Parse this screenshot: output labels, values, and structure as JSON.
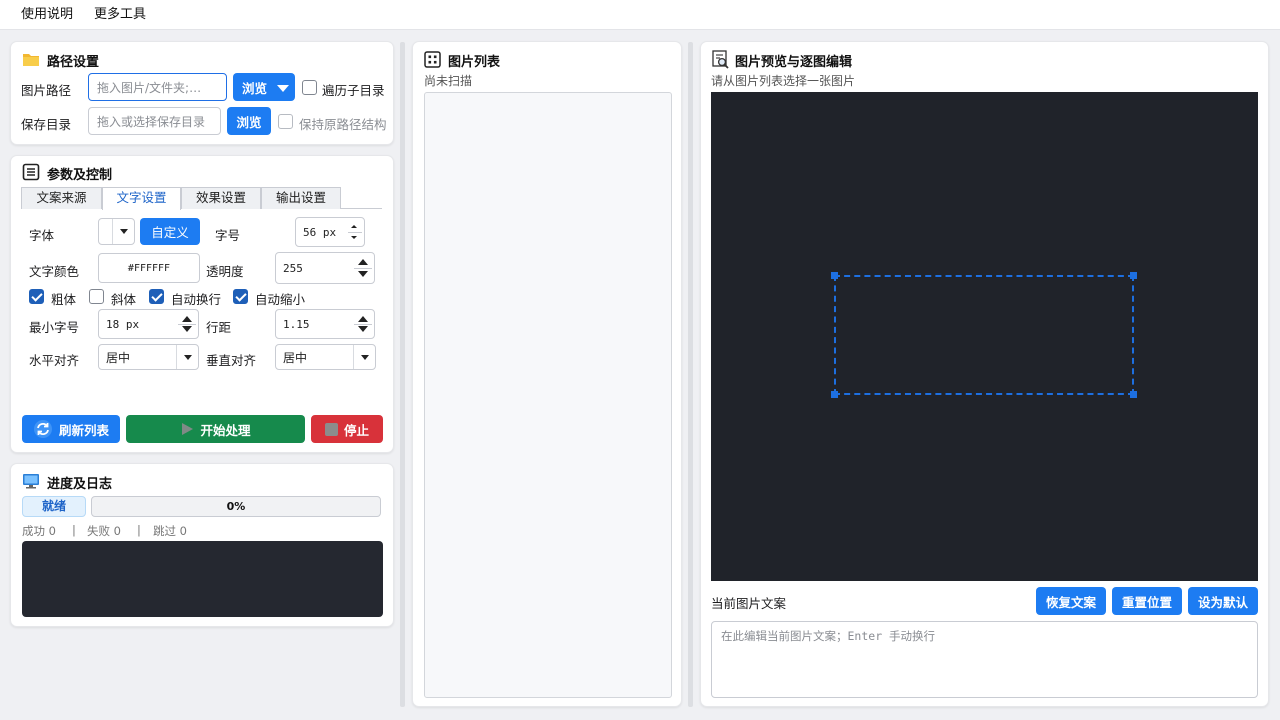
{
  "menu": {
    "help": "使用说明",
    "more_tools": "更多工具"
  },
  "path_settings": {
    "title": "路径设置",
    "image_path_label": "图片路径",
    "image_path_placeholder": "拖入图片/文件夹;…",
    "browse_label": "浏览",
    "recursive_label": "遍历子目录",
    "recursive_checked": false,
    "save_dir_label": "保存目录",
    "save_dir_placeholder": "拖入或选择保存目录",
    "save_browse_label": "浏览",
    "keep_structure_label": "保持原路径结构",
    "keep_structure_checked": false
  },
  "params": {
    "title": "参数及控制",
    "tabs": [
      "文案来源",
      "文字设置",
      "效果设置",
      "输出设置"
    ],
    "active_tab": 1,
    "font_label": "字体",
    "font_value": "",
    "custom_button": "自定义",
    "size_label": "字号",
    "size_value": "56 px",
    "color_label": "文字颜色",
    "color_value": "#FFFFFF",
    "opacity_label": "透明度",
    "opacity_value": "255",
    "bold_label": "粗体",
    "bold_checked": true,
    "italic_label": "斜体",
    "italic_checked": false,
    "wrap_label": "自动换行",
    "wrap_checked": true,
    "shrink_label": "自动缩小",
    "shrink_checked": true,
    "min_size_label": "最小字号",
    "min_size_value": "18 px",
    "line_spacing_label": "行距",
    "line_spacing_value": "1.15",
    "h_align_label": "水平对齐",
    "h_align_value": "居中",
    "v_align_label": "垂直对齐",
    "v_align_value": "居中",
    "refresh_button": "刷新列表",
    "start_button": "开始处理",
    "stop_button": "停止",
    "colors": {
      "blue": "#1d7cf2",
      "green": "#168a4c",
      "red": "#d8323a"
    }
  },
  "progress": {
    "title": "进度及日志",
    "status_badge": "就绪",
    "percent": 0,
    "percent_text": "0%",
    "success_label": "成功 0",
    "fail_label": "失败 0",
    "skip_label": "跳过 0",
    "separator": "|"
  },
  "image_list": {
    "title": "图片列表",
    "status": "尚未扫描"
  },
  "preview": {
    "title": "图片预览与逐图编辑",
    "hint": "请从图片列表选择一张图片",
    "caption_label": "当前图片文案",
    "restore_button": "恢复文案",
    "reset_position_button": "重置位置",
    "set_default_button": "设为默认",
    "caption_placeholder": "在此编辑当前图片文案；Enter 手动换行",
    "canvas_color": "#20232a",
    "selection_color": "#1d6fe0"
  }
}
